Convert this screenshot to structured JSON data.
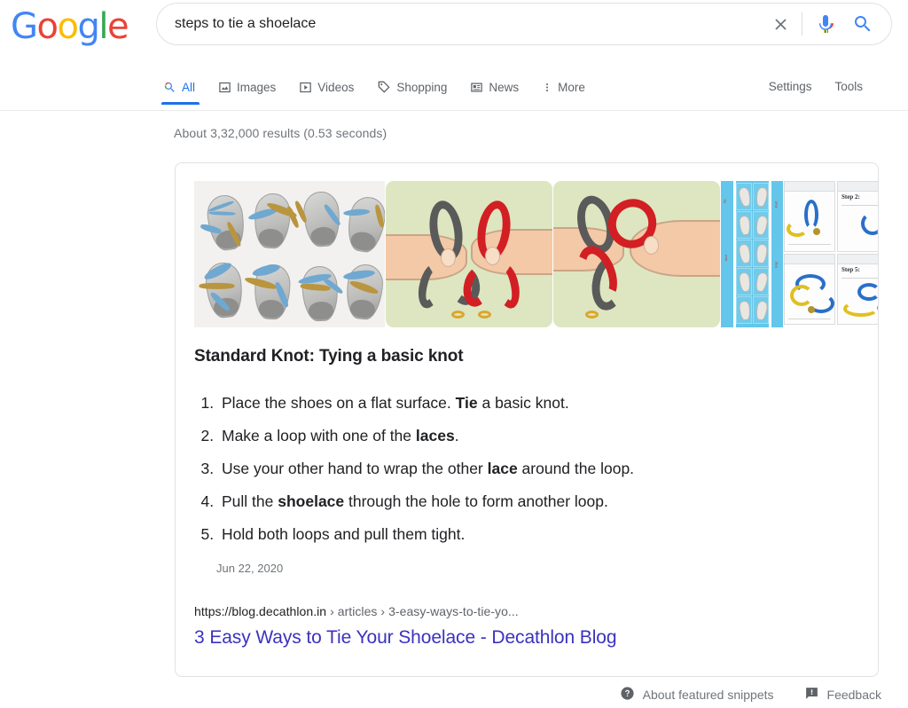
{
  "logo": {
    "name": "Google",
    "letters": [
      {
        "ch": "G",
        "color": "#4285f4"
      },
      {
        "ch": "o",
        "color": "#ea4335"
      },
      {
        "ch": "o",
        "color": "#fbbc05"
      },
      {
        "ch": "g",
        "color": "#4285f4"
      },
      {
        "ch": "l",
        "color": "#34a853"
      },
      {
        "ch": "e",
        "color": "#ea4335"
      }
    ]
  },
  "search": {
    "value": "steps to tie a shoelace",
    "placeholder": "Search",
    "clear_icon": "close-icon",
    "mic_icon": "microphone-icon",
    "search_icon": "search-icon"
  },
  "nav": {
    "tabs": [
      {
        "label": "All",
        "icon": "search-icon",
        "active": true
      },
      {
        "label": "Images",
        "icon": "image-icon",
        "active": false
      },
      {
        "label": "Videos",
        "icon": "video-icon",
        "active": false
      },
      {
        "label": "Shopping",
        "icon": "tag-icon",
        "active": false
      },
      {
        "label": "News",
        "icon": "newspaper-icon",
        "active": false
      },
      {
        "label": "More",
        "icon": "more-vertical-icon",
        "active": false
      }
    ],
    "settings_label": "Settings",
    "tools_label": "Tools",
    "active_color": "#1a73e8"
  },
  "results": {
    "stats": "About 3,32,000 results (0.53 seconds)"
  },
  "snippet": {
    "title": "Standard Knot: Tying a basic knot",
    "steps": [
      {
        "num": 1,
        "parts": [
          {
            "t": "Place the shoes on a flat surface. ",
            "b": false
          },
          {
            "t": "Tie",
            "b": true
          },
          {
            "t": " a basic knot.",
            "b": false
          }
        ]
      },
      {
        "num": 2,
        "parts": [
          {
            "t": "Make a loop with one of the ",
            "b": false
          },
          {
            "t": "laces",
            "b": true
          },
          {
            "t": ".",
            "b": false
          }
        ]
      },
      {
        "num": 3,
        "parts": [
          {
            "t": "Use your other hand to wrap the other ",
            "b": false
          },
          {
            "t": "lace",
            "b": true
          },
          {
            "t": " around the loop.",
            "b": false
          }
        ]
      },
      {
        "num": 4,
        "parts": [
          {
            "t": "Pull the ",
            "b": false
          },
          {
            "t": "shoelace",
            "b": true
          },
          {
            "t": " through the hole to form another loop.",
            "b": false
          }
        ]
      },
      {
        "num": 5,
        "parts": [
          {
            "t": "Hold both loops and pull them tight.",
            "b": false
          }
        ]
      }
    ],
    "date": "Jun 22, 2020",
    "url_domain": "https://blog.decathlon.in",
    "url_crumbs": " › articles › 3-easy-ways-to-tie-yo...",
    "link_title": "3 Easy Ways to Tie Your Shoelace - Decathlon Blog",
    "link_color": "#3b32bf",
    "carousel": [
      {
        "alt": "grid of sketched sneakers with blue and tan laces being tied",
        "kind": "shoe-sketch-grid"
      },
      {
        "alt": "hands holding gray and red shoelace loops on green background",
        "kind": "hands-two-loops"
      },
      {
        "alt": "hands crossing gray and red shoelaces on green background",
        "kind": "hands-crossing"
      },
      {
        "alt": "blue poster grid of shoe lacing photos",
        "kind": "blue-photo-grid"
      },
      {
        "alt": "step by step lacing diagrams",
        "kind": "step-diagrams",
        "labels": [
          "Step 2:",
          "Step 5:"
        ]
      }
    ]
  },
  "footer": {
    "about_label": "About featured snippets",
    "about_icon": "help-circle-icon",
    "feedback_label": "Feedback",
    "feedback_icon": "feedback-flag-icon"
  }
}
